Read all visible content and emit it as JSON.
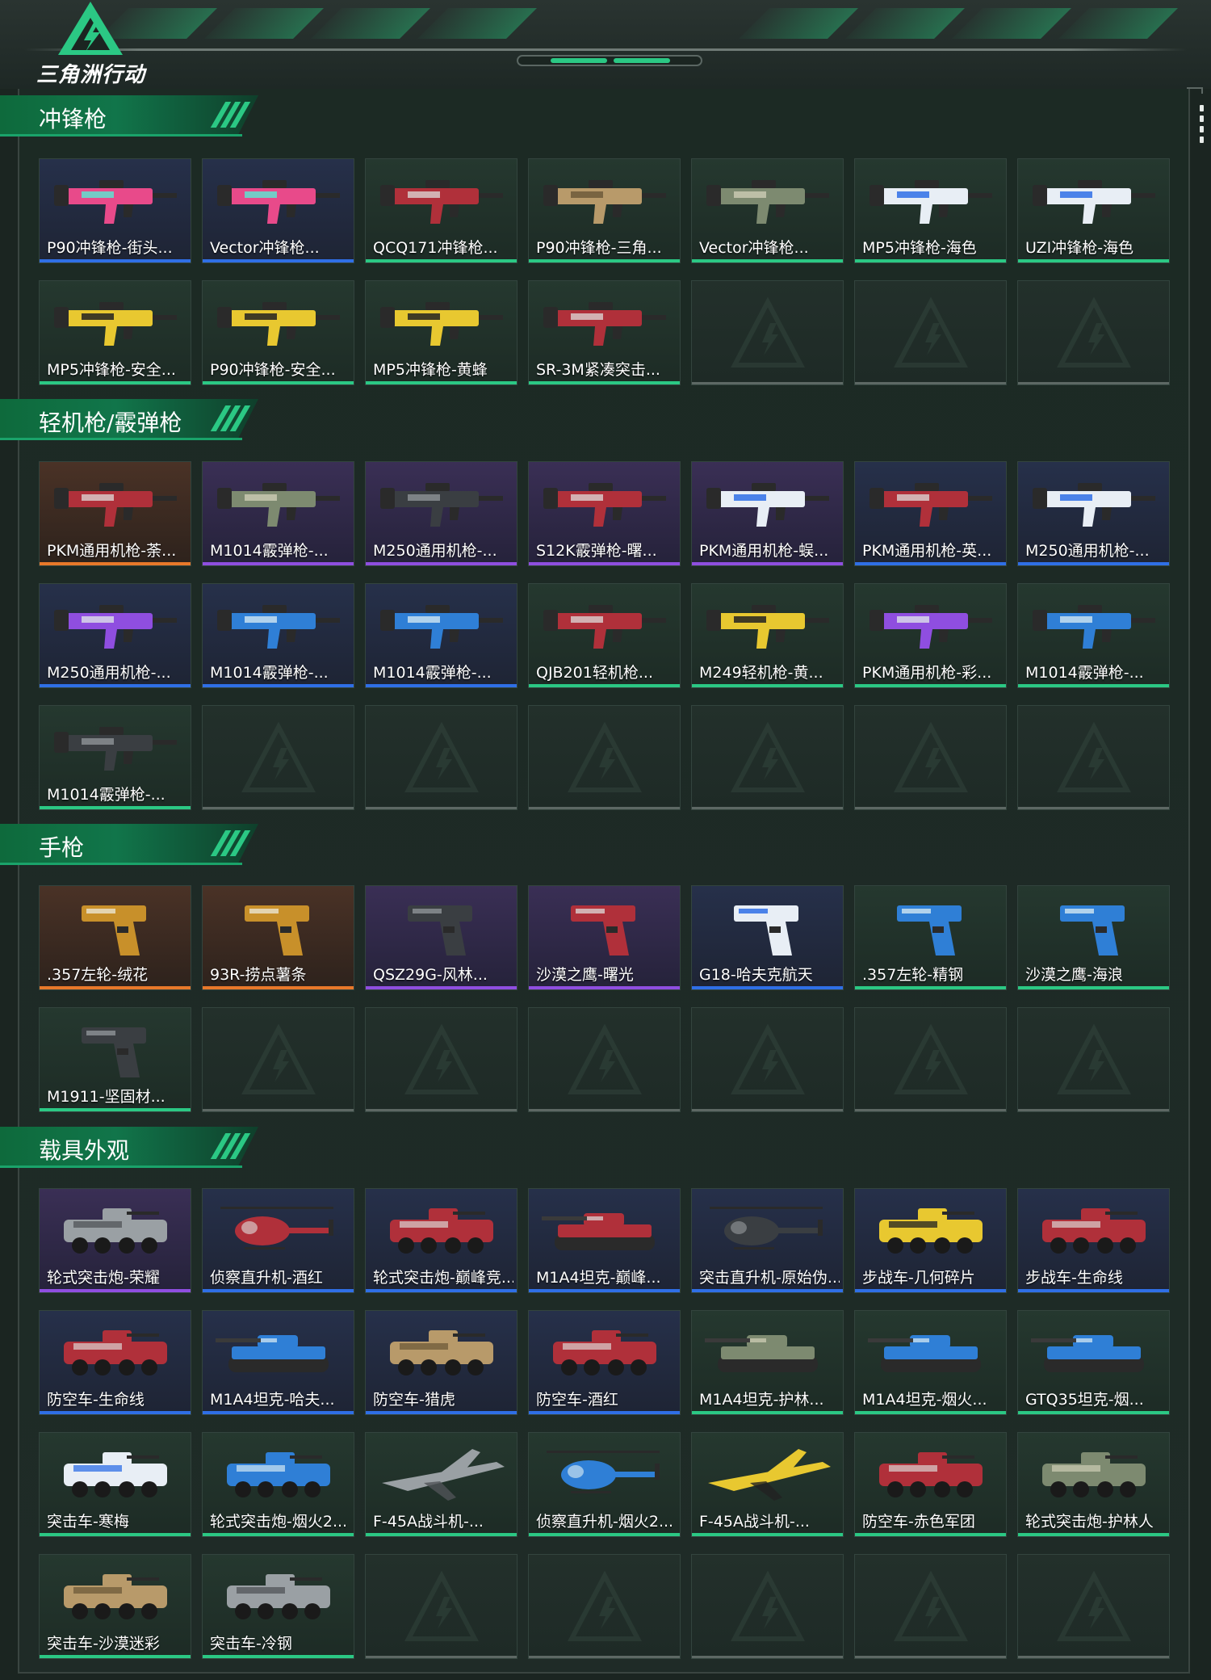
{
  "header": {
    "logo_text": "三角洲行动",
    "logo_icon": "delta-triangle-logo-icon"
  },
  "colors": {
    "accent": "#2bc884",
    "section_header": "#0e6a3c",
    "rarity_orange": "#e8782a",
    "rarity_purple": "#8f4ee0",
    "rarity_blue": "#2f6fe6",
    "rarity_green": "#2bc884",
    "rarity_empty": "#5d6864"
  },
  "sections": [
    {
      "title": "冲锋枪",
      "items": [
        {
          "label": "P90冲锋枪-街头...",
          "rarity": "blue",
          "art": "gun-pink"
        },
        {
          "label": "Vector冲锋枪...",
          "rarity": "blue",
          "art": "gun-pink"
        },
        {
          "label": "QCQ171冲锋枪...",
          "rarity": "green",
          "art": "gun-red"
        },
        {
          "label": "P90冲锋枪-三角...",
          "rarity": "green",
          "art": "gun-tan"
        },
        {
          "label": "Vector冲锋枪...",
          "rarity": "green",
          "art": "gun-camo"
        },
        {
          "label": "MP5冲锋枪-海色",
          "rarity": "green",
          "art": "gun-white"
        },
        {
          "label": "UZI冲锋枪-海色",
          "rarity": "green",
          "art": "gun-white"
        },
        {
          "label": "MP5冲锋枪-安全...",
          "rarity": "green",
          "art": "gun-yellow"
        },
        {
          "label": "P90冲锋枪-安全...",
          "rarity": "green",
          "art": "gun-yellow"
        },
        {
          "label": "MP5冲锋枪-黄蜂",
          "rarity": "green",
          "art": "gun-yellow"
        },
        {
          "label": "SR-3M紧凑突击...",
          "rarity": "green",
          "art": "gun-red"
        },
        {
          "empty": true
        },
        {
          "empty": true
        },
        {
          "empty": true
        }
      ]
    },
    {
      "title": "轻机枪/霰弹枪",
      "items": [
        {
          "label": "PKM通用机枪-荼...",
          "rarity": "orange",
          "art": "gun-red"
        },
        {
          "label": "M1014霰弹枪-...",
          "rarity": "purple",
          "art": "gun-camo"
        },
        {
          "label": "M250通用机枪-...",
          "rarity": "purple",
          "art": "gun-dark"
        },
        {
          "label": "S12K霰弹枪-曙...",
          "rarity": "purple",
          "art": "gun-red"
        },
        {
          "label": "PKM通用机枪-蜈...",
          "rarity": "purple",
          "art": "gun-white"
        },
        {
          "label": "PKM通用机枪-英...",
          "rarity": "blue",
          "art": "gun-red"
        },
        {
          "label": "M250通用机枪-...",
          "rarity": "blue",
          "art": "gun-white"
        },
        {
          "label": "M250通用机枪-...",
          "rarity": "blue",
          "art": "gun-purple"
        },
        {
          "label": "M1014霰弹枪-...",
          "rarity": "blue",
          "art": "gun-blue"
        },
        {
          "label": "M1014霰弹枪-...",
          "rarity": "blue",
          "art": "gun-blue"
        },
        {
          "label": "QJB201轻机枪...",
          "rarity": "green",
          "art": "gun-red"
        },
        {
          "label": "M249轻机枪-黄...",
          "rarity": "green",
          "art": "gun-yellow"
        },
        {
          "label": "PKM通用机枪-彩...",
          "rarity": "green",
          "art": "gun-purple"
        },
        {
          "label": "M1014霰弹枪-...",
          "rarity": "green",
          "art": "gun-blue"
        },
        {
          "label": "M1014霰弹枪-...",
          "rarity": "green",
          "art": "gun-dark"
        },
        {
          "empty": true
        },
        {
          "empty": true
        },
        {
          "empty": true
        },
        {
          "empty": true
        },
        {
          "empty": true
        },
        {
          "empty": true
        }
      ]
    },
    {
      "title": "手枪",
      "items": [
        {
          "label": ".357左轮-绒花",
          "rarity": "orange",
          "art": "pistol-gold"
        },
        {
          "label": "93R-捞点薯条",
          "rarity": "orange",
          "art": "pistol-gold"
        },
        {
          "label": "QSZ29G-风林...",
          "rarity": "purple",
          "art": "pistol-dark"
        },
        {
          "label": "沙漠之鹰-曙光",
          "rarity": "purple",
          "art": "pistol-red"
        },
        {
          "label": "G18-哈夫克航天",
          "rarity": "blue",
          "art": "pistol-white"
        },
        {
          "label": ".357左轮-精钢",
          "rarity": "green",
          "art": "pistol-blue"
        },
        {
          "label": "沙漠之鹰-海浪",
          "rarity": "green",
          "art": "pistol-blue"
        },
        {
          "label": "M1911-坚固材...",
          "rarity": "green",
          "art": "pistol-dark"
        },
        {
          "empty": true
        },
        {
          "empty": true
        },
        {
          "empty": true
        },
        {
          "empty": true
        },
        {
          "empty": true
        },
        {
          "empty": true
        }
      ]
    },
    {
      "title": "载具外观",
      "items": [
        {
          "label": "轮式突击炮-荣耀",
          "rarity": "purple",
          "art": "vehicle-grey"
        },
        {
          "label": "侦察直升机-酒红",
          "rarity": "blue",
          "art": "heli-red"
        },
        {
          "label": "轮式突击炮-巅峰竞...",
          "rarity": "blue",
          "art": "vehicle-red"
        },
        {
          "label": "M1A4坦克-巅峰...",
          "rarity": "blue",
          "art": "tank-red"
        },
        {
          "label": "突击直升机-原始伪...",
          "rarity": "blue",
          "art": "heli-dark"
        },
        {
          "label": "步战车-几何碎片",
          "rarity": "blue",
          "art": "vehicle-yellow"
        },
        {
          "label": "步战车-生命线",
          "rarity": "blue",
          "art": "vehicle-red"
        },
        {
          "label": "防空车-生命线",
          "rarity": "blue",
          "art": "vehicle-red"
        },
        {
          "label": "M1A4坦克-哈夫...",
          "rarity": "blue",
          "art": "tank-blue"
        },
        {
          "label": "防空车-猎虎",
          "rarity": "blue",
          "art": "vehicle-tan"
        },
        {
          "label": "防空车-酒红",
          "rarity": "blue",
          "art": "vehicle-red"
        },
        {
          "label": "M1A4坦克-护林...",
          "rarity": "green",
          "art": "tank-camo"
        },
        {
          "label": "M1A4坦克-烟火...",
          "rarity": "green",
          "art": "tank-blue"
        },
        {
          "label": "GTQ35坦克-烟...",
          "rarity": "green",
          "art": "tank-blue"
        },
        {
          "label": "突击车-寒梅",
          "rarity": "green",
          "art": "vehicle-white"
        },
        {
          "label": "轮式突击炮-烟火2...",
          "rarity": "green",
          "art": "vehicle-blue"
        },
        {
          "label": "F-45A战斗机-...",
          "rarity": "green",
          "art": "jet-grey"
        },
        {
          "label": "侦察直升机-烟火2...",
          "rarity": "green",
          "art": "heli-blue"
        },
        {
          "label": "F-45A战斗机-...",
          "rarity": "green",
          "art": "jet-yellow"
        },
        {
          "label": "防空车-赤色军团",
          "rarity": "green",
          "art": "vehicle-red"
        },
        {
          "label": "轮式突击炮-护林人",
          "rarity": "green",
          "art": "vehicle-camo"
        },
        {
          "label": "突击车-沙漠迷彩",
          "rarity": "green",
          "art": "vehicle-tan"
        },
        {
          "label": "突击车-冷钢",
          "rarity": "green",
          "art": "vehicle-grey"
        },
        {
          "empty": true
        },
        {
          "empty": true
        },
        {
          "empty": true
        },
        {
          "empty": true
        },
        {
          "empty": true
        }
      ]
    }
  ]
}
